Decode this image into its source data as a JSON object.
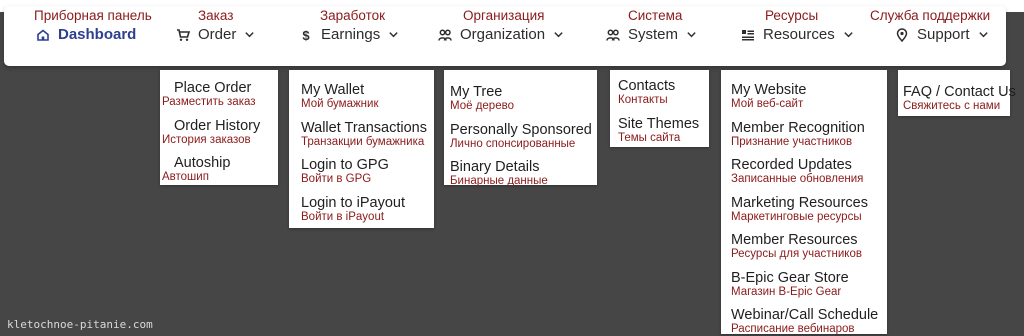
{
  "nav": [
    {
      "key": "dashboard",
      "ru": "Приборная панель",
      "label": "Dashboard",
      "icon": "home-icon",
      "chevron": false,
      "active": true
    },
    {
      "key": "order",
      "ru": "Заказ",
      "label": "Order",
      "icon": "cart-icon",
      "chevron": true
    },
    {
      "key": "earnings",
      "ru": "Заработок",
      "label": "Earnings",
      "icon": "dollar-icon",
      "chevron": true
    },
    {
      "key": "organization",
      "ru": "Организация",
      "label": "Organization",
      "icon": "users-icon",
      "chevron": true
    },
    {
      "key": "system",
      "ru": "Система",
      "label": "System",
      "icon": "users-icon",
      "chevron": true
    },
    {
      "key": "resources",
      "ru": "Ресурсы",
      "label": "Resources",
      "icon": "list-icon",
      "chevron": true
    },
    {
      "key": "support",
      "ru": "Служба поддержки",
      "label": "Support",
      "icon": "map-pin-icon",
      "chevron": true
    }
  ],
  "menus": {
    "order": [
      {
        "en": "Place Order",
        "ru": "Разместить заказ"
      },
      {
        "en": "Order History",
        "ru": "История заказов"
      },
      {
        "en": "Autoship",
        "ru": "Автошип"
      }
    ],
    "earnings": [
      {
        "en": "My Wallet",
        "ru": "Мой бумажник"
      },
      {
        "en": "Wallet Transactions",
        "ru": "Транзакции бумажника"
      },
      {
        "en": "Login to GPG",
        "ru": "Войти в GPG"
      },
      {
        "en": "Login to iPayout",
        "ru": "Войти в iPayout"
      }
    ],
    "organization": [
      {
        "en": "My Tree",
        "ru": "Моё дерево"
      },
      {
        "en": "Personally Sponsored",
        "ru": "Лично спонсированные"
      },
      {
        "en": "Binary Details",
        "ru": "Бинарные данные"
      }
    ],
    "system": [
      {
        "en": "Contacts",
        "ru": "Контакты"
      },
      {
        "en": "Site Themes",
        "ru": "Темы сайта"
      }
    ],
    "resources": [
      {
        "en": "My Website",
        "ru": "Мой веб-сайт"
      },
      {
        "en": "Member Recognition",
        "ru": "Признание участников"
      },
      {
        "en": "Recorded Updates",
        "ru": "Записанные обновления"
      },
      {
        "en": "Marketing Resources",
        "ru": "Маркетинговые ресурсы"
      },
      {
        "en": "Member Resources",
        "ru": "Ресурсы для участников"
      },
      {
        "en": "B-Epic Gear Store",
        "ru": "Магазин B-Epic Gear"
      },
      {
        "en": "Webinar/Call Schedule",
        "ru": "Расписание вебинаров"
      }
    ],
    "support": [
      {
        "en": "FAQ / Contact Us",
        "ru": "Свяжитесь с нами"
      }
    ]
  },
  "watermark": "kletochnoe-pitanie.com",
  "colors": {
    "background": "#464646",
    "russian_text": "#8b1a1a",
    "active_nav": "#2e3f8f",
    "navbar": "#ffffff"
  }
}
